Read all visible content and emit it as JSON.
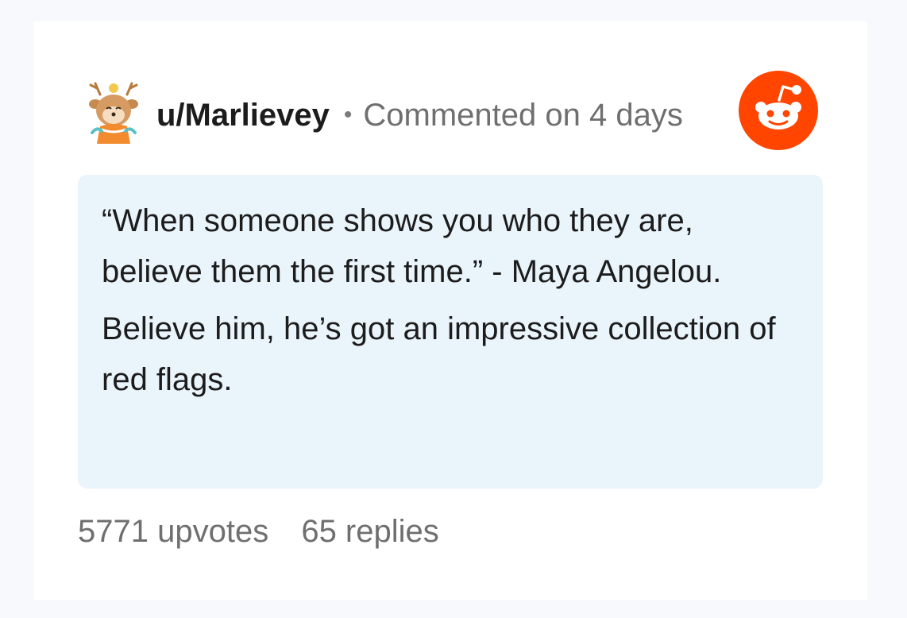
{
  "comment": {
    "username": "u/Marlievey",
    "separator": "•",
    "meta": "Commented on 4 days",
    "paragraphs": [
      "“When someone shows you who they are, believe them the first time.” - Maya Angelou.",
      "Believe him, he’s got an impressive collection of red flags."
    ],
    "upvotes": "5771 upvotes",
    "replies": "65 replies"
  },
  "icons": {
    "avatar": "snoo-deer-avatar",
    "brand": "reddit-logo-icon"
  },
  "colors": {
    "reddit_orange": "#ff4500",
    "quote_background": "#eaf4fb",
    "meta_text": "#6f6f6f"
  }
}
